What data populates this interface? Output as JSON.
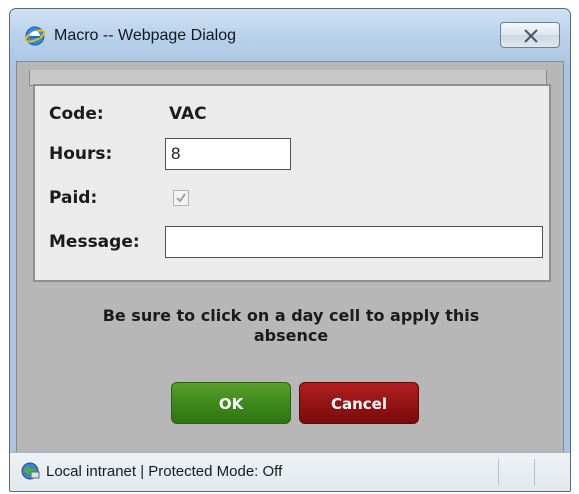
{
  "window": {
    "title": "Macro -- Webpage Dialog"
  },
  "form": {
    "code_label": "Code:",
    "code_value": "VAC",
    "hours_label": "Hours:",
    "hours_value": "8",
    "paid_label": "Paid:",
    "paid_checked": true,
    "message_label": "Message:",
    "message_value": ""
  },
  "hint": {
    "line1": "Be sure to click on a day cell to apply this",
    "line2": "absence"
  },
  "buttons": {
    "ok_label": "OK",
    "cancel_label": "Cancel"
  },
  "status": {
    "text": "Local intranet | Protected Mode: Off"
  },
  "icons": {
    "app": "ie-icon",
    "close": "close-icon",
    "check": "checkmark-icon",
    "zone": "local-intranet-globe-icon"
  },
  "colors": {
    "ok": "#3e8a1c",
    "cancel": "#941414",
    "panel": "#ebebeb",
    "dialog_bg": "#b7b7b7"
  }
}
